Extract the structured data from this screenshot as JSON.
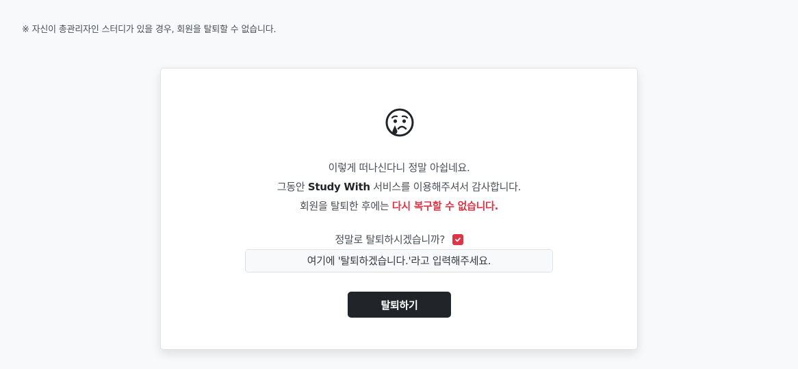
{
  "notice": "※ 자신이 총관리자인 스터디가 있을 경우, 회원을 탈퇴할 수 없습니다.",
  "card": {
    "icon": "crying-face-icon",
    "line1": "이렇게 떠나신다니 정말 아쉽네요.",
    "line2_prefix": "그동안 ",
    "line2_brand": "Study With",
    "line2_suffix": " 서비스를 이용해주셔서 감사합니다.",
    "line3_prefix": "회원을 탈퇴한 후에는 ",
    "line3_warning": "다시 복구할 수 없습니다.",
    "confirm_label": "정말로 탈퇴하시겠습니까?",
    "confirm_checked": true,
    "input_placeholder": "여기에 '탈퇴하겠습니다.'라고 입력해주세요.",
    "input_value": "",
    "submit_label": "탈퇴하기"
  },
  "colors": {
    "background": "#f8f9fa",
    "warning": "#dc3545",
    "button": "#212529"
  }
}
